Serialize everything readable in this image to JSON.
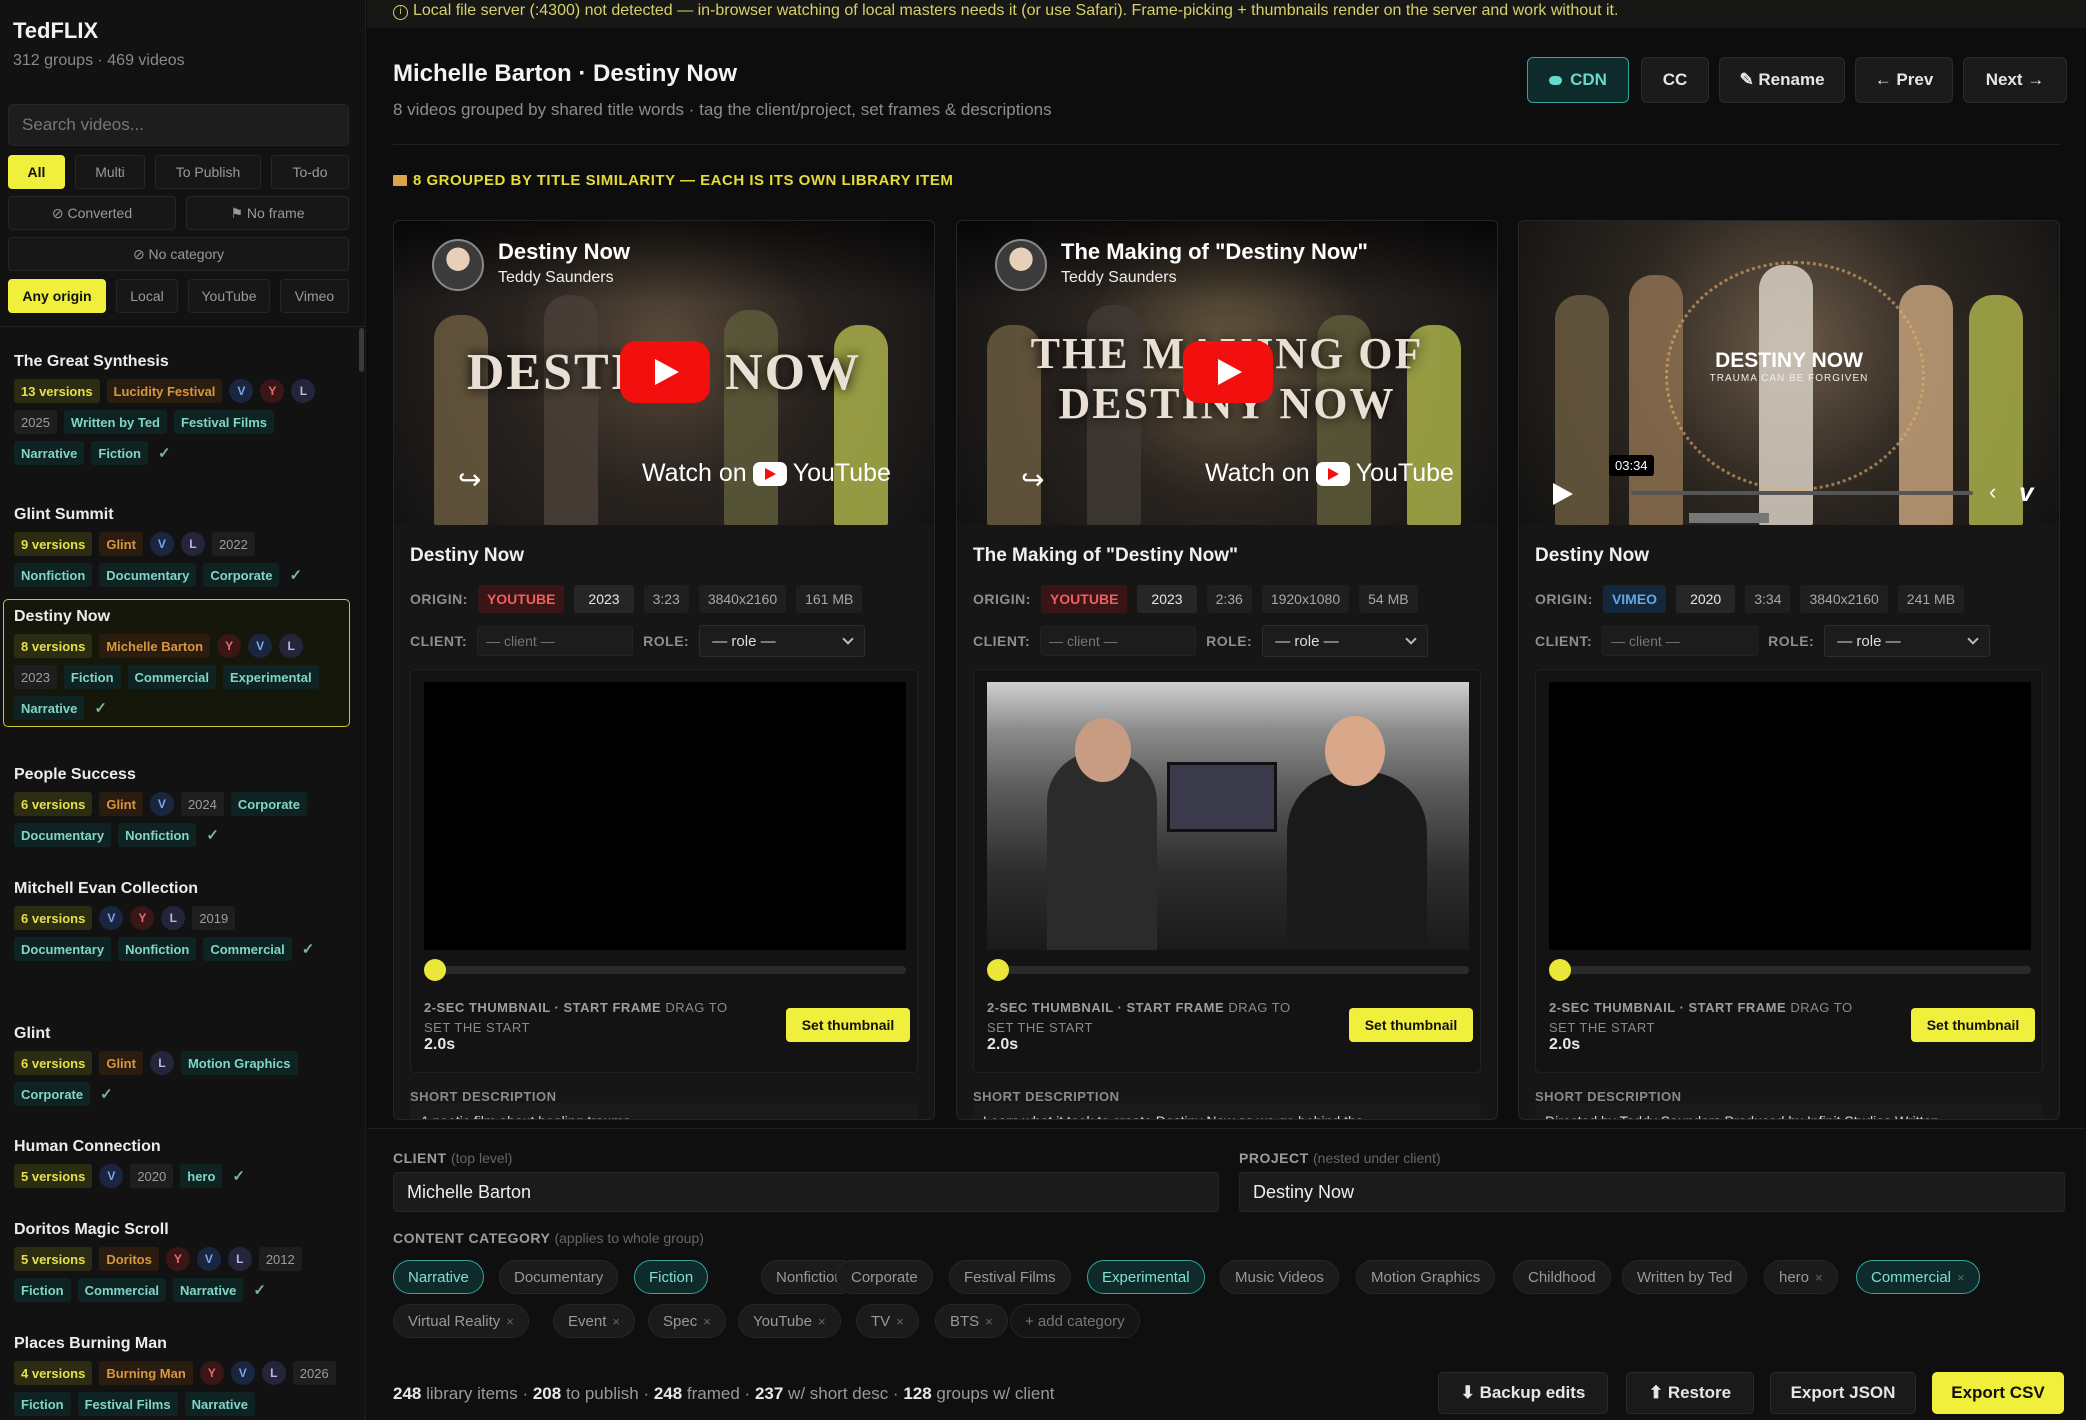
{
  "app": {
    "name": "TedFLIX",
    "summary": "312 groups · 469 videos"
  },
  "search": {
    "placeholder": "Search videos..."
  },
  "filters": {
    "row1": [
      "All",
      "Multi",
      "To Publish",
      "To-do"
    ],
    "converted": "⊘ Converted",
    "no_frame": "⚑ No frame",
    "no_category": "⊘ No category",
    "origin": [
      "Any origin",
      "Local",
      "YouTube",
      "Vimeo"
    ]
  },
  "groups": [
    {
      "name": "The Great Synthesis"
    },
    {
      "name": "Glint Summit"
    },
    {
      "name": "Destiny Now"
    },
    {
      "name": "People Success"
    },
    {
      "name": "Mitchell Evan Collection"
    },
    {
      "name": "Glint"
    },
    {
      "name": "Human Connection"
    },
    {
      "name": "Doritos Magic Scroll"
    },
    {
      "name": "Places Burning Man"
    }
  ],
  "group_tags": {
    "g0": [
      "13 versions",
      "Lucidity Festival",
      "V",
      "Y",
      "L",
      "2025",
      "Written by Ted",
      "Festival Films",
      "Narrative",
      "Fiction",
      "✓"
    ],
    "g1": [
      "9 versions",
      "Glint",
      "V",
      "L",
      "2022",
      "Nonfiction",
      "Documentary",
      "Corporate",
      "✓"
    ],
    "g2": [
      "8 versions",
      "Michelle Barton",
      "Y",
      "V",
      "L",
      "2023",
      "Fiction",
      "Commercial",
      "Experimental",
      "Narrative",
      "✓"
    ],
    "g3": [
      "6 versions",
      "Glint",
      "V",
      "2024",
      "Corporate",
      "Documentary",
      "Nonfiction",
      "✓"
    ],
    "g4": [
      "6 versions",
      "V",
      "Y",
      "L",
      "2019",
      "Documentary",
      "Nonfiction",
      "Commercial",
      "✓"
    ],
    "g5": [
      "6 versions",
      "Glint",
      "L",
      "Motion Graphics",
      "Corporate",
      "✓"
    ],
    "g6": [
      "5 versions",
      "V",
      "2020",
      "hero",
      "✓"
    ],
    "g7": [
      "5 versions",
      "Doritos",
      "Y",
      "V",
      "L",
      "2012",
      "Fiction",
      "Commercial",
      "Narrative",
      "✓"
    ],
    "g8": [
      "4 versions",
      "Burning Man",
      "Y",
      "V",
      "L",
      "2026",
      "Fiction",
      "Festival Films",
      "Narrative"
    ]
  },
  "warning": "Local file server (:4300) not detected — in-browser watching of local masters needs it (or use Safari). Frame-picking + thumbnails render on the server and work without it.",
  "header": {
    "title": "Michelle Barton · Destiny Now",
    "subtitle": "8 videos grouped by shared title words · tag the client/project, set frames & descriptions",
    "buttons": {
      "cdn": "CDN",
      "cc": "CC",
      "rename": "✎ Rename",
      "prev": "← Prev",
      "next": "Next →"
    }
  },
  "section_label": "8 GROUPED BY TITLE SIMILARITY — EACH IS ITS OWN LIBRARY ITEM",
  "cards": [
    {
      "player": {
        "title": "Destiny Now",
        "author": "Teddy Saunders",
        "big": "DESTINY NOW",
        "watch": "Watch on",
        "yt": "YouTube"
      },
      "title": "Destiny Now",
      "origin": "YOUTUBE",
      "year": "2023",
      "duration": "3:23",
      "res": "3840x2160",
      "size": "161 MB",
      "client_ph": "— client —",
      "role": "— role —",
      "thumb_caption": "2-SEC THUMBNAIL · START FRAME",
      "thumb_hint": "DRAG TO SET THE START",
      "thumb_value": "2.0s",
      "thumb_position": 0.0,
      "set_btn": "Set thumbnail",
      "desc_label": "SHORT DESCRIPTION",
      "desc": "A poetic film about healing trauma..."
    },
    {
      "player": {
        "title": "The Making of \"Destiny Now\"",
        "author": "Teddy Saunders",
        "big": "THE MAKING OF DESTINY NOW",
        "watch": "Watch on",
        "yt": "YouTube"
      },
      "title": "The Making of \"Destiny Now\"",
      "origin": "YOUTUBE",
      "year": "2023",
      "duration": "2:36",
      "res": "1920x1080",
      "size": "54 MB",
      "client_ph": "— client —",
      "role": "— role —",
      "thumb_caption": "2-SEC THUMBNAIL · START FRAME",
      "thumb_hint": "DRAG TO SET THE START",
      "thumb_value": "2.0s",
      "thumb_position": 0.0,
      "set_btn": "Set thumbnail",
      "desc_label": "SHORT DESCRIPTION",
      "desc": "Learn what it took to create Destiny Now as we go behind the..."
    },
    {
      "player": {
        "big": "DESTINY NOW",
        "tag": "TRAUMA CAN BE FORGIVEN",
        "time": "03:34"
      },
      "title": "Destiny Now",
      "origin": "VIMEO",
      "year": "2020",
      "duration": "3:34",
      "res": "3840x2160",
      "size": "241 MB",
      "client_ph": "— client —",
      "role": "— role —",
      "thumb_caption": "2-SEC THUMBNAIL · START FRAME",
      "thumb_hint": "DRAG TO SET THE START",
      "thumb_value": "2.0s",
      "thumb_position": 0.0,
      "set_btn": "Set thumbnail",
      "desc_label": "SHORT DESCRIPTION",
      "desc": "Directed by Teddy Saunders Produced by Infinit Studios Written..."
    }
  ],
  "labels": {
    "origin": "ORIGIN:",
    "client": "CLIENT:",
    "role": "ROLE:"
  },
  "bottom": {
    "client_label": "CLIENT",
    "client_hint": "(top level)",
    "client_value": "Michelle Barton",
    "project_label": "PROJECT",
    "project_hint": "(nested under client)",
    "project_value": "Destiny Now",
    "category_label": "CONTENT CATEGORY",
    "category_hint": "(applies to whole group)",
    "categories": [
      {
        "label": "Narrative",
        "on": true
      },
      {
        "label": "Documentary",
        "on": false
      },
      {
        "label": "Fiction",
        "on": true
      },
      {
        "label": "Nonfiction",
        "on": false
      },
      {
        "label": "Corporate",
        "on": false
      },
      {
        "label": "Festival Films",
        "on": false
      },
      {
        "label": "Experimental",
        "on": true
      },
      {
        "label": "Music Videos",
        "on": false
      },
      {
        "label": "Motion Graphics",
        "on": false
      },
      {
        "label": "Childhood",
        "on": false
      },
      {
        "label": "Written by Ted",
        "on": false
      },
      {
        "label": "hero",
        "on": false,
        "x": true
      },
      {
        "label": "Commercial",
        "on": true,
        "x": true
      },
      {
        "label": "Virtual Reality",
        "on": false,
        "x": true
      },
      {
        "label": "Event",
        "on": false,
        "x": true
      },
      {
        "label": "Spec",
        "on": false,
        "x": true
      },
      {
        "label": "YouTube",
        "on": false,
        "x": true
      },
      {
        "label": "TV",
        "on": false,
        "x": true
      },
      {
        "label": "BTS",
        "on": false,
        "x": true
      }
    ],
    "add_category": "+ add category",
    "stats": {
      "items": "248",
      "items_l": " library items · ",
      "publish": "208",
      "publish_l": " to publish · ",
      "framed": "248",
      "framed_l": " framed · ",
      "desc": "237",
      "desc_l": " w/ short desc · ",
      "groups": "128",
      "groups_l": " groups w/ client"
    },
    "buttons": {
      "backup": "⬇ Backup edits",
      "restore": "⬆ Restore",
      "json": "Export JSON",
      "csv": "Export CSV"
    }
  }
}
